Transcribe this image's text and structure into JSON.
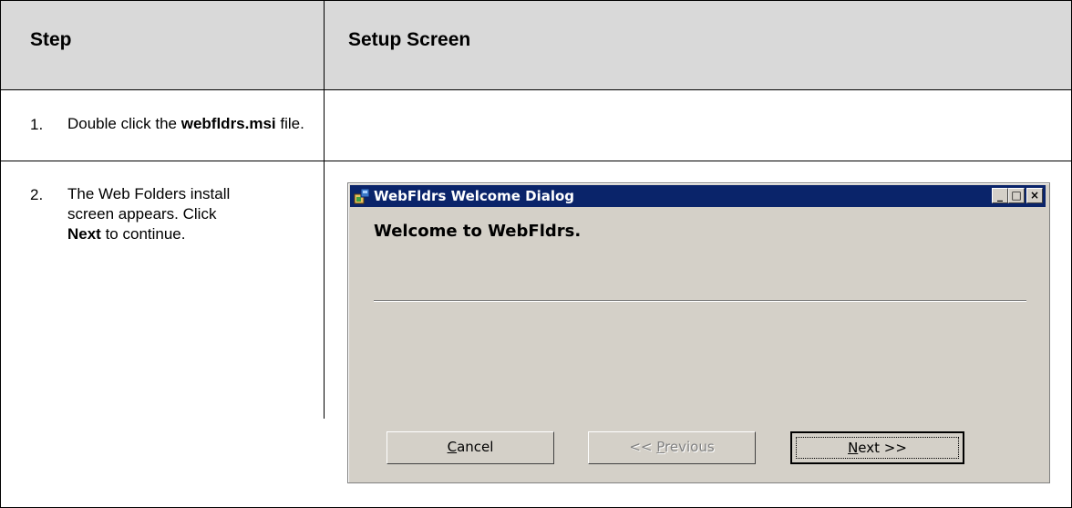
{
  "table": {
    "header": {
      "step": "Step",
      "setup_screen": "Setup Screen"
    },
    "rows": [
      {
        "number": "1.",
        "text_before": "Double click the ",
        "text_bold": "webfldrs.msi",
        "text_after": " file."
      },
      {
        "number": "2.",
        "line1": "The Web Folders install",
        "line2": "screen appears. Click",
        "line3_bold": "Next",
        "line3_after": " to continue."
      }
    ]
  },
  "dialog": {
    "title": "WebFldrs Welcome Dialog",
    "app_icon": "installer-icon",
    "welcome_text": "Welcome to WebFldrs.",
    "titlebar_buttons": {
      "minimize": "_",
      "maximize": "□",
      "close": "×"
    },
    "buttons": {
      "cancel": {
        "mnemonic": "C",
        "rest": "ancel",
        "enabled": true
      },
      "previous": {
        "prefix": "<< ",
        "mnemonic": "P",
        "rest": "revious",
        "enabled": false
      },
      "next": {
        "mnemonic": "N",
        "rest": "ext >>",
        "enabled": true,
        "default": true
      }
    }
  }
}
